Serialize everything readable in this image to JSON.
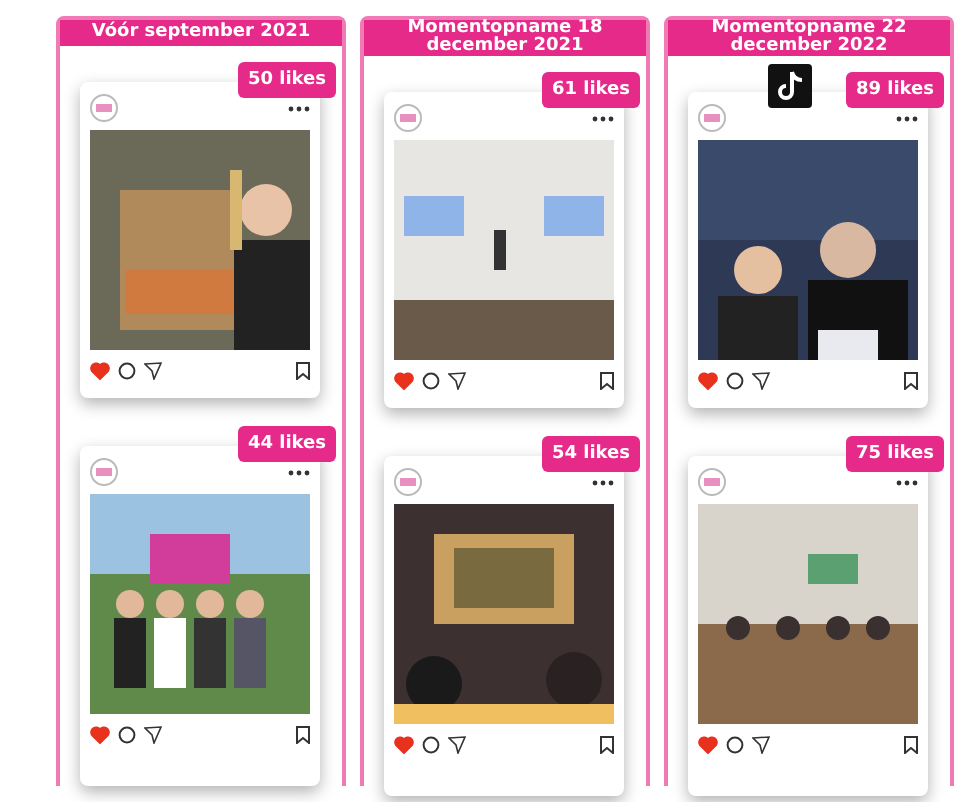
{
  "columns": [
    {
      "title": "Vóór september 2021",
      "posts": [
        {
          "likes": "50 likes",
          "liked": true,
          "tiktok": false
        },
        {
          "likes": "44 likes",
          "liked": true,
          "tiktok": false
        }
      ]
    },
    {
      "title": "Momentopname 18 december 2021",
      "posts": [
        {
          "likes": "61 likes",
          "liked": true,
          "tiktok": false
        },
        {
          "likes": "54 likes",
          "liked": true,
          "tiktok": false
        }
      ]
    },
    {
      "title": "Momentopname 22 december 2022",
      "posts": [
        {
          "likes": "89 likes",
          "liked": true,
          "tiktok": true
        },
        {
          "likes": "75 likes",
          "liked": true,
          "tiktok": false
        }
      ]
    }
  ]
}
